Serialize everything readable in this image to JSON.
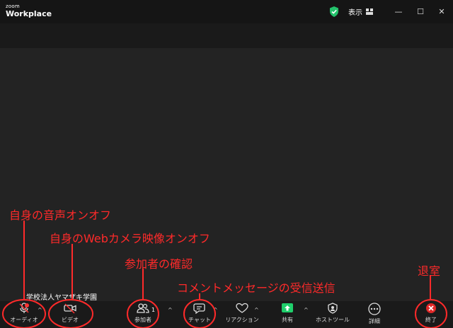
{
  "app": {
    "brand_small": "zoom",
    "brand_main": "Workplace"
  },
  "titlebar": {
    "view_label": "表示",
    "min": "—",
    "max": "☐",
    "close": "✕"
  },
  "participant": {
    "name": "学校法人ヤマザキ学園"
  },
  "toolbar": {
    "audio": "オーディオ",
    "video": "ビデオ",
    "participants": "参加者",
    "participant_count": "1",
    "chat": "チャット",
    "reactions": "リアクション",
    "share": "共有",
    "host_tools": "ホストツール",
    "more": "詳細",
    "end": "終了"
  },
  "annotations": {
    "audio": "自身の音声オンオフ",
    "video": "自身のWebカメラ映像オンオフ",
    "participants": "参加者の確認",
    "chat": "コメントメッセージの受信送信",
    "leave": "退室"
  },
  "colors": {
    "annotation": "#ff2a2a",
    "shield": "#23c26b",
    "share": "#1fcf6b",
    "end": "#e02828",
    "background": "#232323",
    "toolbar": "#1a1a1a"
  }
}
